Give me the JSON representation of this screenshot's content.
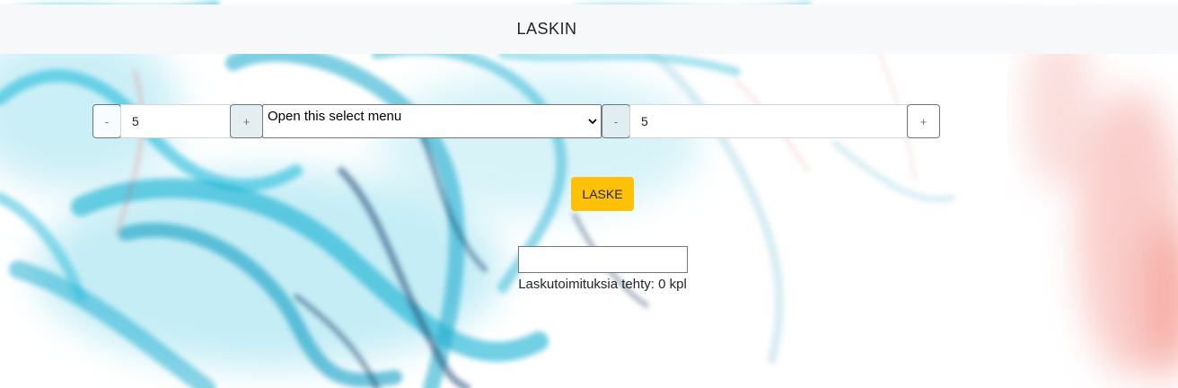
{
  "header": {
    "title": "LASKIN"
  },
  "calculator": {
    "first": {
      "minus_label": "-",
      "value": "5",
      "plus_label": "+"
    },
    "operation_select": {
      "selected": "Open this select menu"
    },
    "second": {
      "minus_label": "-",
      "value": "5",
      "plus_label": "+"
    },
    "compute_label": "LASKE",
    "result_value": "",
    "counter_text": "Laskutoimituksia tehty: 0 kpl"
  },
  "colors": {
    "accent": "#ffc107",
    "header_bg": "#f7f8f9",
    "smoke_cyan": "#13b5d6",
    "smoke_red": "#f04a3a"
  }
}
